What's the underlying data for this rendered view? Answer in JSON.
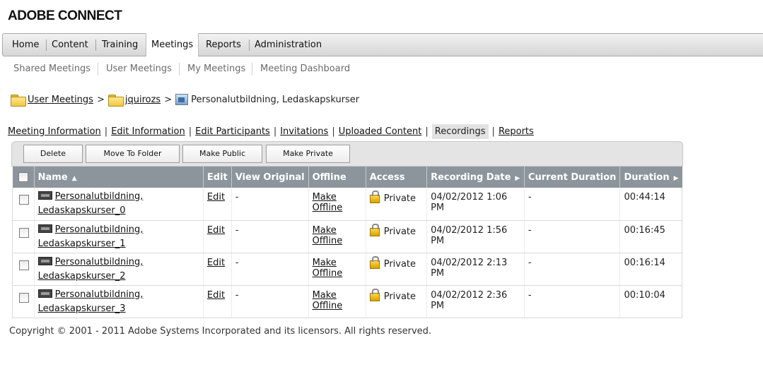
{
  "app": {
    "logo": "ADOBE CONNECT"
  },
  "topnav": [
    {
      "label": "Home"
    },
    {
      "label": "Content"
    },
    {
      "label": "Training"
    },
    {
      "label": "Meetings"
    },
    {
      "label": "Reports"
    },
    {
      "label": "Administration"
    }
  ],
  "subnav": [
    {
      "label": "Shared Meetings"
    },
    {
      "label": "User Meetings"
    },
    {
      "label": "My Meetings"
    },
    {
      "label": "Meeting Dashboard"
    }
  ],
  "breadcrumb": {
    "items": [
      "User Meetings",
      "jquirozs",
      "Personalutbildning, Ledaskapskurser"
    ],
    "separator": ">"
  },
  "tabs": [
    {
      "label": "Meeting Information"
    },
    {
      "label": "Edit Information"
    },
    {
      "label": "Edit Participants"
    },
    {
      "label": "Invitations"
    },
    {
      "label": "Uploaded Content"
    },
    {
      "label": "Recordings"
    },
    {
      "label": "Reports"
    }
  ],
  "actions": {
    "delete": "Delete",
    "move": "Move To Folder",
    "public": "Make Public",
    "private": "Make Private"
  },
  "table": {
    "headers": {
      "name": "Name",
      "edit": "Edit",
      "view_original": "View Original",
      "offline": "Offline",
      "access": "Access",
      "recording_date": "Recording Date",
      "current_duration": "Current Duration",
      "duration": "Duration"
    },
    "rows": [
      {
        "name1": "Personalutbildning,",
        "name2": "Ledaskapskurser_0",
        "edit": "Edit",
        "view_original": "-",
        "offline": "Make Offline",
        "access": "Private",
        "date": "04/02/2012 1:06 PM",
        "current_duration": "-",
        "duration": "00:44:14"
      },
      {
        "name1": "Personalutbildning,",
        "name2": "Ledaskapskurser_1",
        "edit": "Edit",
        "view_original": "-",
        "offline": "Make Offline",
        "access": "Private",
        "date": "04/02/2012 1:56 PM",
        "current_duration": "-",
        "duration": "00:16:45"
      },
      {
        "name1": "Personalutbildning,",
        "name2": "Ledaskapskurser_2",
        "edit": "Edit",
        "view_original": "-",
        "offline": "Make Offline",
        "access": "Private",
        "date": "04/02/2012 2:13 PM",
        "current_duration": "-",
        "duration": "00:16:14"
      },
      {
        "name1": "Personalutbildning,",
        "name2": "Ledaskapskurser_3",
        "edit": "Edit",
        "view_original": "-",
        "offline": "Make Offline",
        "access": "Private",
        "date": "04/02/2012 2:36 PM",
        "current_duration": "-",
        "duration": "00:10:04"
      }
    ]
  },
  "footer": {
    "copyright": "Copyright © 2001 - 2011 Adobe Systems Incorporated and its licensors. All rights reserved."
  }
}
